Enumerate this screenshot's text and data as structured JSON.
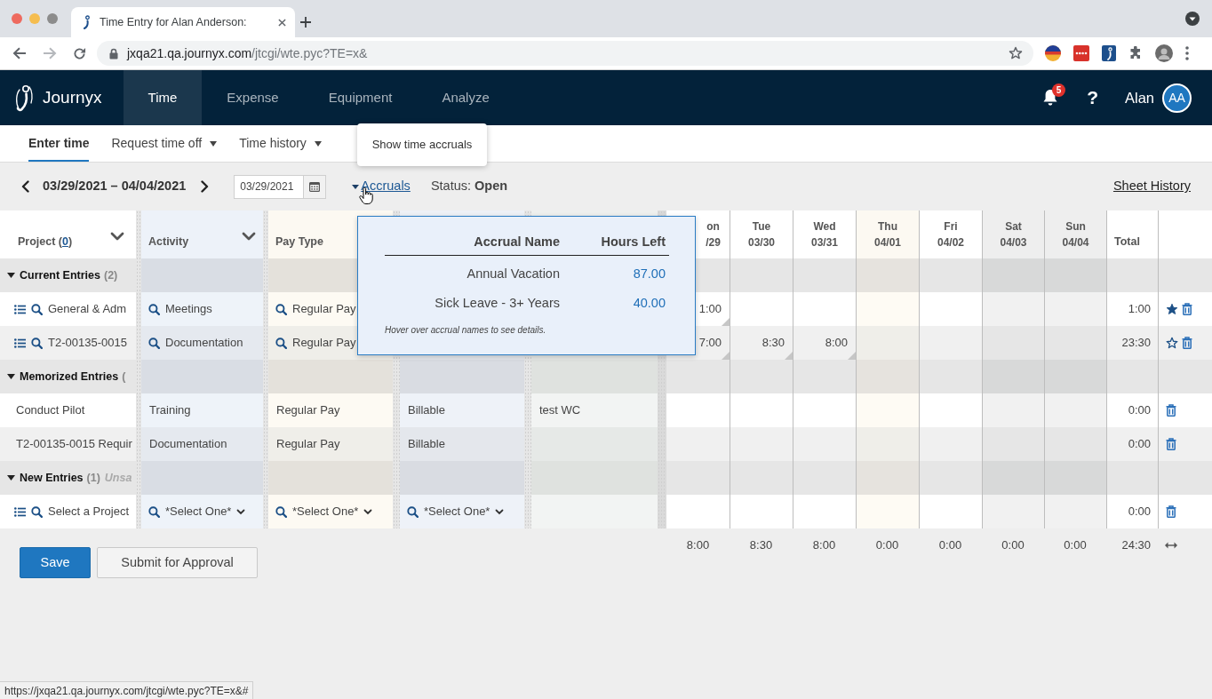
{
  "browser": {
    "tab_title": "Time Entry for Alan Anderson:",
    "url": {
      "host": "jxqa21.qa.journyx.com",
      "path": "/jtcgi/wte.pyc?TE=x&"
    },
    "status_url": "https://jxqa21.qa.journyx.com/jtcgi/wte.pyc?TE=x&#"
  },
  "app": {
    "brand": "Journyx",
    "tabs": [
      {
        "label": "Time",
        "selected": true
      },
      {
        "label": "Expense",
        "selected": false
      },
      {
        "label": "Equipment",
        "selected": false
      },
      {
        "label": "Analyze",
        "selected": false
      }
    ],
    "notification_count": "5",
    "help": "?",
    "user_name": "Alan",
    "user_initials": "AA"
  },
  "subnav": {
    "items": [
      {
        "label": "Enter time",
        "selected": true,
        "dropdown": false
      },
      {
        "label": "Request time off",
        "selected": false,
        "dropdown": true
      },
      {
        "label": "Time history",
        "selected": false,
        "dropdown": true
      }
    ],
    "tooltip": "Show time accruals"
  },
  "toolbar": {
    "period": "03/29/2021 – 04/04/2021",
    "date": "03/29/2021",
    "accruals_link": {
      "label": "Accruals",
      "expanded": true
    },
    "status": "Status: **Open**",
    "sheet_history": "Sheet History"
  },
  "accruals_popup": {
    "columns": [
      "Accrual Name",
      "Hours Left"
    ],
    "rows": [
      {
        "name": "Annual Vacation",
        "hours_left": "87.00"
      },
      {
        "name": "Sick Leave - 3+ Years",
        "hours_left": "40.00"
      }
    ],
    "hint": "Hover over accrual names to see details."
  },
  "table": {
    "project_header": {
      "label": "Project (",
      "count": "0",
      "after": ")",
      "menu": true
    },
    "columns": [
      {
        "label": "Activity",
        "menu": true
      },
      {
        "label": "Pay Type"
      }
    ],
    "days": [
      {
        "day": "on",
        "date": "/29",
        "today": false,
        "weekend": false
      },
      {
        "day": "Tue",
        "date": "03/30",
        "today": false,
        "weekend": false
      },
      {
        "day": "Wed",
        "date": "03/31",
        "today": false,
        "weekend": false
      },
      {
        "day": "Thu",
        "date": "04/01",
        "today": true,
        "weekend": false
      },
      {
        "day": "Fri",
        "date": "04/02",
        "today": false,
        "weekend": false
      },
      {
        "day": "Sat",
        "date": "04/03",
        "today": false,
        "weekend": true
      },
      {
        "day": "Sun",
        "date": "04/04",
        "today": false,
        "weekend": true
      }
    ],
    "total_header": "Total",
    "groups": [
      {
        "title": "Current Entries",
        "count": "(2)",
        "expanded": true,
        "rows": [
          {
            "kind": "entry",
            "cells": {
              "project": "General & Adm",
              "activity": "Meetings",
              "pay_type": "Regular Pay"
            },
            "hours": [
              "1:00"
            ],
            "total": "1:00",
            "starred": true
          },
          {
            "kind": "entry",
            "cells": {
              "project": "T2-00135-0015",
              "activity": "Documentation",
              "pay_type": "Regular Pay"
            },
            "hours": [
              "7:00",
              "8:30",
              "8:00"
            ],
            "total": "23:30",
            "starred": false
          }
        ]
      },
      {
        "title": "Memorized Entries",
        "count": "(",
        "expanded": true,
        "rows": [
          {
            "kind": "memorized",
            "cells": {
              "project": "Conduct Pilot",
              "activity": "Training",
              "pay_type": "Regular Pay",
              "column_4": "Billable",
              "column_5": "test WC"
            },
            "total": "0:00"
          },
          {
            "kind": "memorized",
            "cells": {
              "project": "T2-00135-0015 Requir",
              "activity": "Documentation",
              "pay_type": "Regular Pay",
              "column_4": "Billable"
            },
            "total": "0:00"
          }
        ]
      },
      {
        "title": "New Entries",
        "count": "(1)",
        "note": "Unsa",
        "expanded": true,
        "rows": [
          {
            "kind": "new",
            "cells": {
              "project": "Select a Project",
              "activity": "*Select One*",
              "pay_type": "*Select One*",
              "column_4": "*Select One*"
            },
            "total": "0:00"
          }
        ]
      }
    ]
  },
  "totals": {
    "days": [
      "8:00",
      "8:30",
      "8:00",
      "0:00",
      "0:00",
      "0:00",
      "0:00"
    ],
    "total": "24:30"
  },
  "buttons": [
    {
      "label": "Save",
      "kind": "primary"
    },
    {
      "label": "Submit for Approval",
      "kind": "secondary"
    }
  ]
}
